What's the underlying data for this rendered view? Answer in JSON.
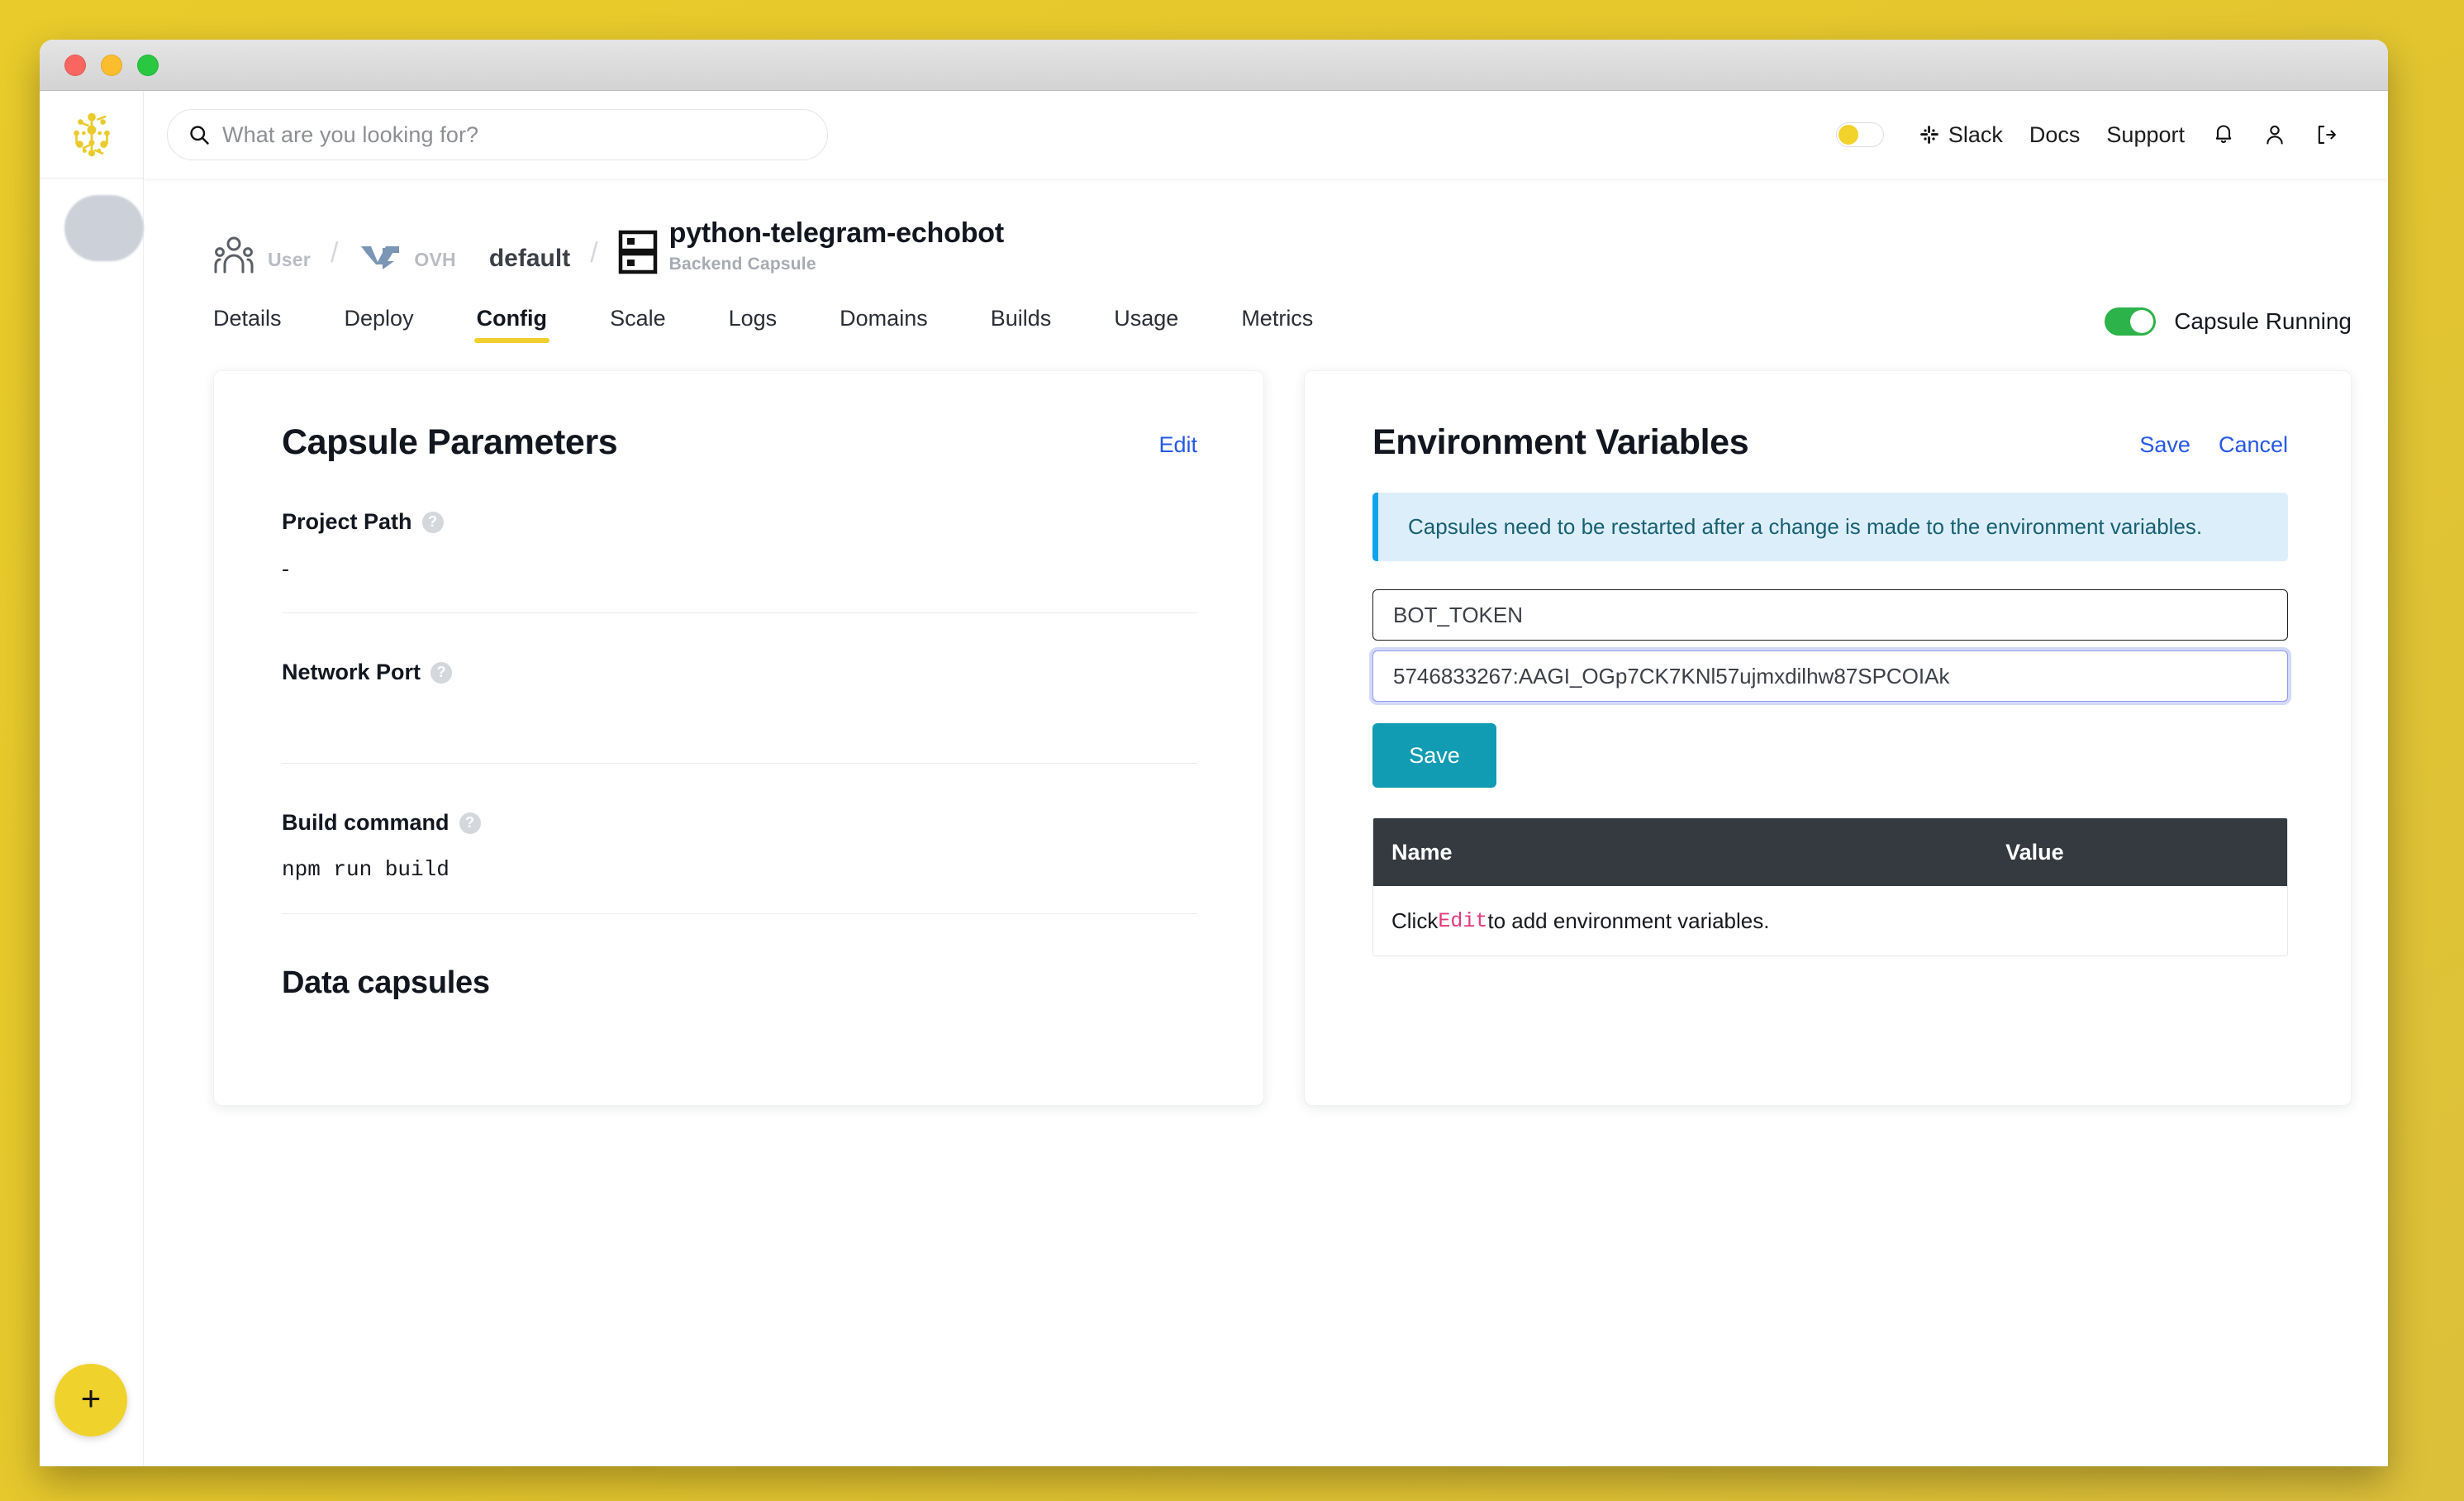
{
  "window": {
    "traffic_lights": [
      "close",
      "minimize",
      "zoom"
    ]
  },
  "sidebar": {
    "logo_name": "scalingo-logo",
    "add_button_label": "+"
  },
  "topbar": {
    "search": {
      "placeholder": "What are you looking for?",
      "value": ""
    },
    "theme_toggle": {
      "state": "off",
      "knob_color": "#f2d32c"
    },
    "links": [
      {
        "label": "Slack",
        "icon": "slack-icon"
      },
      {
        "label": "Docs",
        "icon": null
      },
      {
        "label": "Support",
        "icon": null
      }
    ],
    "icons": [
      {
        "name": "bell-icon"
      },
      {
        "name": "user-icon"
      },
      {
        "name": "logout-icon"
      }
    ]
  },
  "breadcrumb": {
    "items": [
      {
        "icon": "users-icon",
        "main": "",
        "sub": "User"
      },
      {
        "icon": "ovh-icon",
        "main": "",
        "sub": "OVH"
      },
      {
        "icon": null,
        "main": "default",
        "sub": ""
      }
    ],
    "separator": "/",
    "capsule": {
      "icon": "capsule-icon",
      "name": "python-telegram-echobot",
      "kind": "Backend Capsule"
    }
  },
  "tabs": [
    {
      "label": "Details",
      "active": false
    },
    {
      "label": "Deploy",
      "active": false
    },
    {
      "label": "Config",
      "active": true
    },
    {
      "label": "Scale",
      "active": false
    },
    {
      "label": "Logs",
      "active": false
    },
    {
      "label": "Domains",
      "active": false
    },
    {
      "label": "Builds",
      "active": false
    },
    {
      "label": "Usage",
      "active": false
    },
    {
      "label": "Metrics",
      "active": false
    }
  ],
  "capsule_status": {
    "toggle_state": "on",
    "toggle_color": "#2cb34a",
    "label": "Capsule Running"
  },
  "capsule_parameters": {
    "title": "Capsule Parameters",
    "edit_label": "Edit",
    "params": [
      {
        "label": "Project Path",
        "help": "?",
        "value": "-",
        "mono": false
      },
      {
        "label": "Network Port",
        "help": "?",
        "value": "",
        "mono": false
      },
      {
        "label": "Build command",
        "help": "?",
        "value": "npm run build",
        "mono": true
      }
    ],
    "subsection_title": "Data capsules"
  },
  "environment_variables": {
    "title": "Environment Variables",
    "save_label": "Save",
    "cancel_label": "Cancel",
    "notice": "Capsules need to be restarted after a change is made to the environment variables.",
    "name_input": {
      "value": "BOT_TOKEN",
      "placeholder": "Name"
    },
    "value_input": {
      "value": "5746833267:AAGI_OGp7CK7KNl57ujmxdilhw87SPCOIAk",
      "placeholder": "Value",
      "focused": true
    },
    "save_button_label": "Save",
    "save_button_color": "#119cb3",
    "table": {
      "columns": [
        "Name",
        "Value"
      ],
      "empty_prefix": "Click ",
      "empty_code": "Edit",
      "empty_suffix": " to add environment variables.",
      "rows": []
    }
  },
  "colors": {
    "page_background": "#e8c92a",
    "accent_yellow": "#f0cf2e",
    "link_blue": "#2558e6",
    "notice_bg": "#ddeefb",
    "notice_border": "#11a2ee",
    "table_header_bg": "#343a40",
    "code_pink": "#e5397d"
  }
}
